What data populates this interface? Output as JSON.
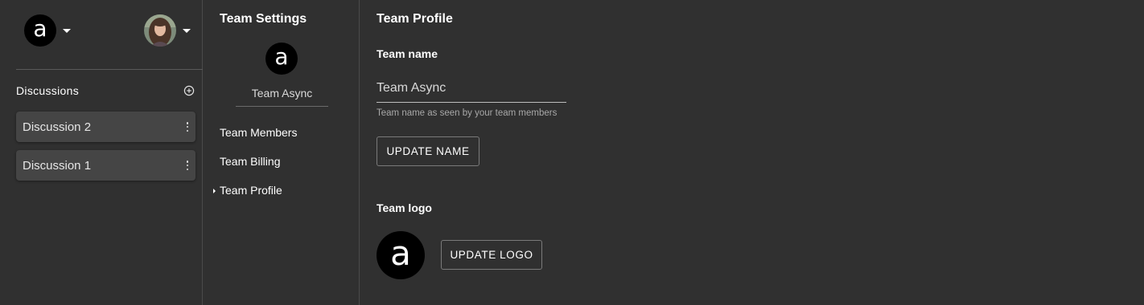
{
  "team": {
    "logo_letter": "a",
    "name": "Team Async"
  },
  "sidebar": {
    "discussions_title": "Discussions",
    "discussions": [
      {
        "label": "Discussion 2"
      },
      {
        "label": "Discussion 1"
      }
    ]
  },
  "settings_nav": {
    "title": "Team Settings",
    "items": [
      {
        "label": "Team Members",
        "active": false
      },
      {
        "label": "Team Billing",
        "active": false
      },
      {
        "label": "Team Profile",
        "active": true
      }
    ]
  },
  "main": {
    "title": "Team Profile",
    "name_label": "Team name",
    "name_value": "Team Async",
    "name_helper": "Team name as seen by your team members",
    "update_name_button": "UPDATE NAME",
    "logo_label": "Team logo",
    "update_logo_button": "UPDATE LOGO"
  },
  "colors": {
    "background": "#303030",
    "card": "#454545",
    "divider": "#4a4a4a"
  },
  "icons": {
    "team_menu": "chevron-down-icon",
    "user_menu": "chevron-down-icon",
    "add_discussion": "add-circle-icon",
    "item_menu": "more-vert-icon",
    "active_nav": "arrow-right-icon"
  }
}
